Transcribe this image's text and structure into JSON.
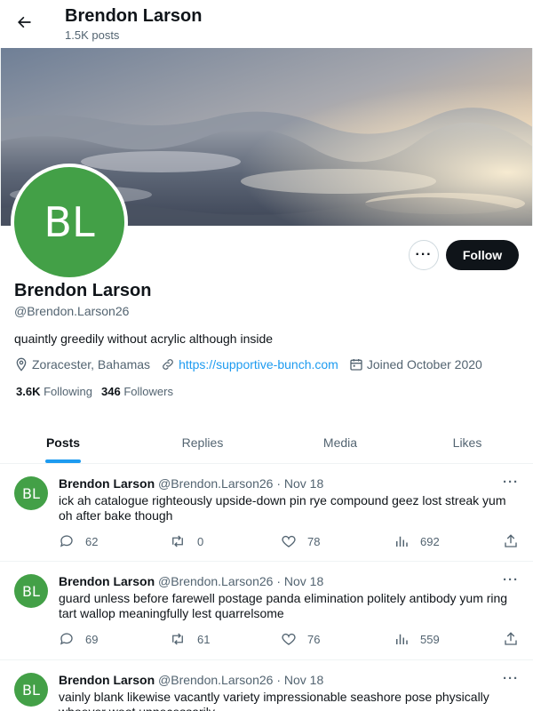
{
  "header": {
    "name": "Brendon Larson",
    "post_count": "1.5K posts"
  },
  "profile": {
    "initials": "BL",
    "name": "Brendon Larson",
    "handle": "@Brendon.Larson26",
    "bio": "quaintly greedily without acrylic although inside",
    "location": "Zoracester, Bahamas",
    "website": "https://supportive-bunch.com",
    "joined": "Joined October 2020",
    "following_count": "3.6K",
    "following_label": "Following",
    "followers_count": "346",
    "followers_label": "Followers",
    "more_label": "···",
    "follow_label": "Follow"
  },
  "tabs": [
    {
      "label": "Posts",
      "active": true
    },
    {
      "label": "Replies",
      "active": false
    },
    {
      "label": "Media",
      "active": false
    },
    {
      "label": "Likes",
      "active": false
    }
  ],
  "posts": [
    {
      "initials": "BL",
      "author": "Brendon Larson",
      "handle": "@Brendon.Larson26",
      "separator": "·",
      "date": "Nov 18",
      "text": "ick ah catalogue righteously upside-down pin rye compound geez lost streak yum oh after bake though",
      "replies": "62",
      "reposts": "0",
      "likes": "78",
      "views": "692"
    },
    {
      "initials": "BL",
      "author": "Brendon Larson",
      "handle": "@Brendon.Larson26",
      "separator": "·",
      "date": "Nov 18",
      "text": "guard unless before farewell postage panda elimination politely antibody yum ring tart wallop meaningfully lest quarrelsome",
      "replies": "69",
      "reposts": "61",
      "likes": "76",
      "views": "559"
    },
    {
      "initials": "BL",
      "author": "Brendon Larson",
      "handle": "@Brendon.Larson26",
      "separator": "·",
      "date": "Nov 18",
      "text": "vainly blank likewise vacantly variety impressionable seashore pose physically whoever woot unnecessarily",
      "replies": "",
      "reposts": "",
      "likes": "",
      "views": ""
    }
  ],
  "colors": {
    "accent": "#1d9bf0",
    "avatar": "#43a047",
    "follow_button": "#0f1419",
    "secondary_text": "#536471"
  },
  "icons": {
    "back": "arrow-left-icon",
    "location": "location-pin-icon",
    "link": "link-icon",
    "calendar": "calendar-icon",
    "reply": "reply-icon",
    "repost": "repost-icon",
    "like": "heart-icon",
    "views": "analytics-icon",
    "share": "share-icon"
  }
}
